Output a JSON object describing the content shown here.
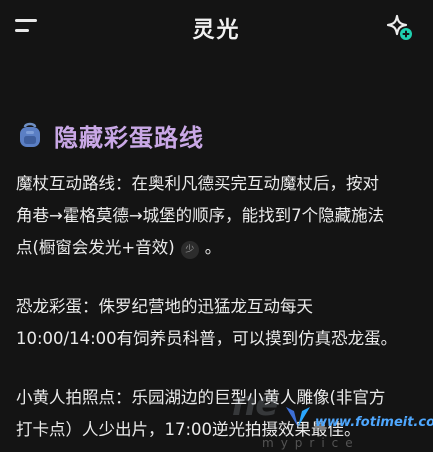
{
  "header": {
    "title": "灵光",
    "menu_icon": "menu-icon",
    "action_icon": "sparkle-plus-icon"
  },
  "section": {
    "icon": "backpack-icon",
    "title": "隐藏彩蛋路线"
  },
  "paragraphs": {
    "p1_line1": "魔杖互动路线：在奥利凡德买完互动魔杖后，按对",
    "p1_line2": "角巷→霍格莫德→城堡的顺序，能找到7个隐藏施法",
    "p1_line3_a": "点(橱窗会发光+音效)",
    "p1_cite": "少",
    "p1_line3_b": "。",
    "p2_line1": "恐龙彩蛋：侏罗纪营地的迅猛龙互动每天",
    "p2_line2": "10:00/14:00有饲养员科普，可以摸到仿真恐龙蛋。",
    "p3_line1": "小黄人拍照点：乐园湖边的巨型小黄人雕像(非官方",
    "p3_line2": "打卡点）人少出片，17:00逆光拍摄效果最佳。"
  },
  "watermark": {
    "url": "www.fotimeit.com",
    "tail": "ne",
    "sub": "myprice"
  },
  "colors": {
    "background": "#141414",
    "accent": "#c9a8e6",
    "text": "#ebebeb"
  }
}
